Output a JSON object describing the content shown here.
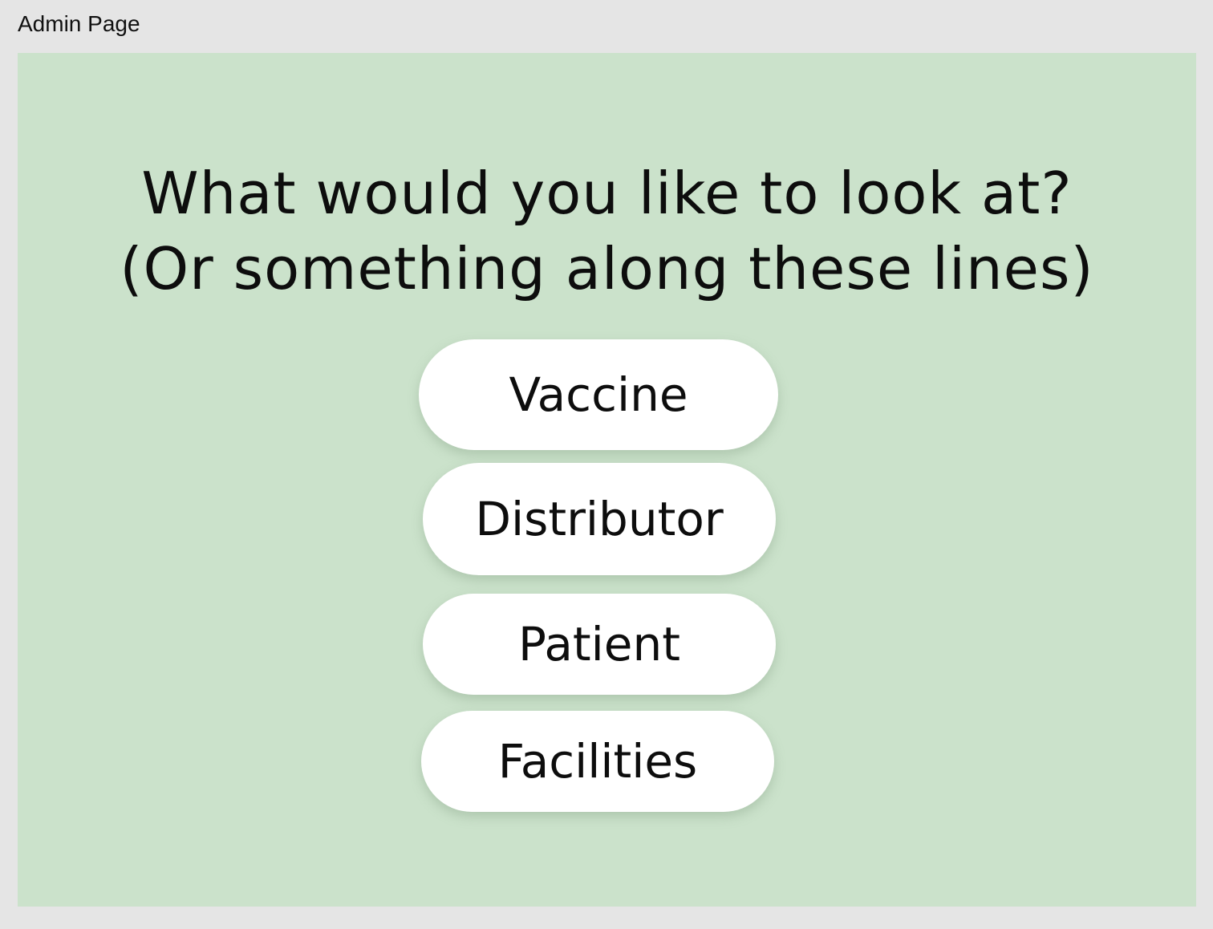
{
  "frame": {
    "title": "Admin Page"
  },
  "main": {
    "headline_line1": "What would you like to look at?",
    "headline_line2": "(Or something along these lines)",
    "options": [
      {
        "label": "Vaccine"
      },
      {
        "label": "Distributor"
      },
      {
        "label": "Patient"
      },
      {
        "label": "Facilities"
      }
    ]
  },
  "colors": {
    "page_background": "#e5e5e5",
    "canvas_background": "#cbe2cb",
    "button_background": "#ffffff",
    "text": "#0d0d0d"
  }
}
